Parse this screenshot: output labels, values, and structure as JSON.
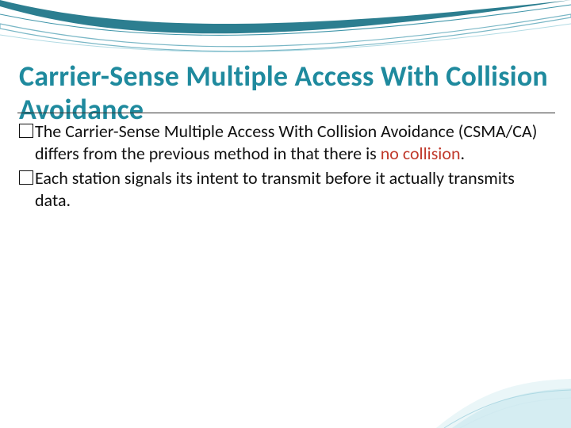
{
  "title": "Carrier-Sense Multiple Access With Collision Avoidance",
  "bullets": [
    {
      "pre": "The Carrier-Sense Multiple Access With Collision Avoidance  (CSMA/CA)  differs from the previous method in that there is ",
      "emph": "no collision",
      "post": "."
    },
    {
      "pre": "Each station signals its intent to transmit before it actually transmits data.",
      "emph": "",
      "post": ""
    }
  ],
  "colors": {
    "title": "#1f8a9e",
    "emphasis": "#c0392b",
    "swooshDark": "#1e6f7d",
    "swooshLight": "#bfe3eb"
  }
}
